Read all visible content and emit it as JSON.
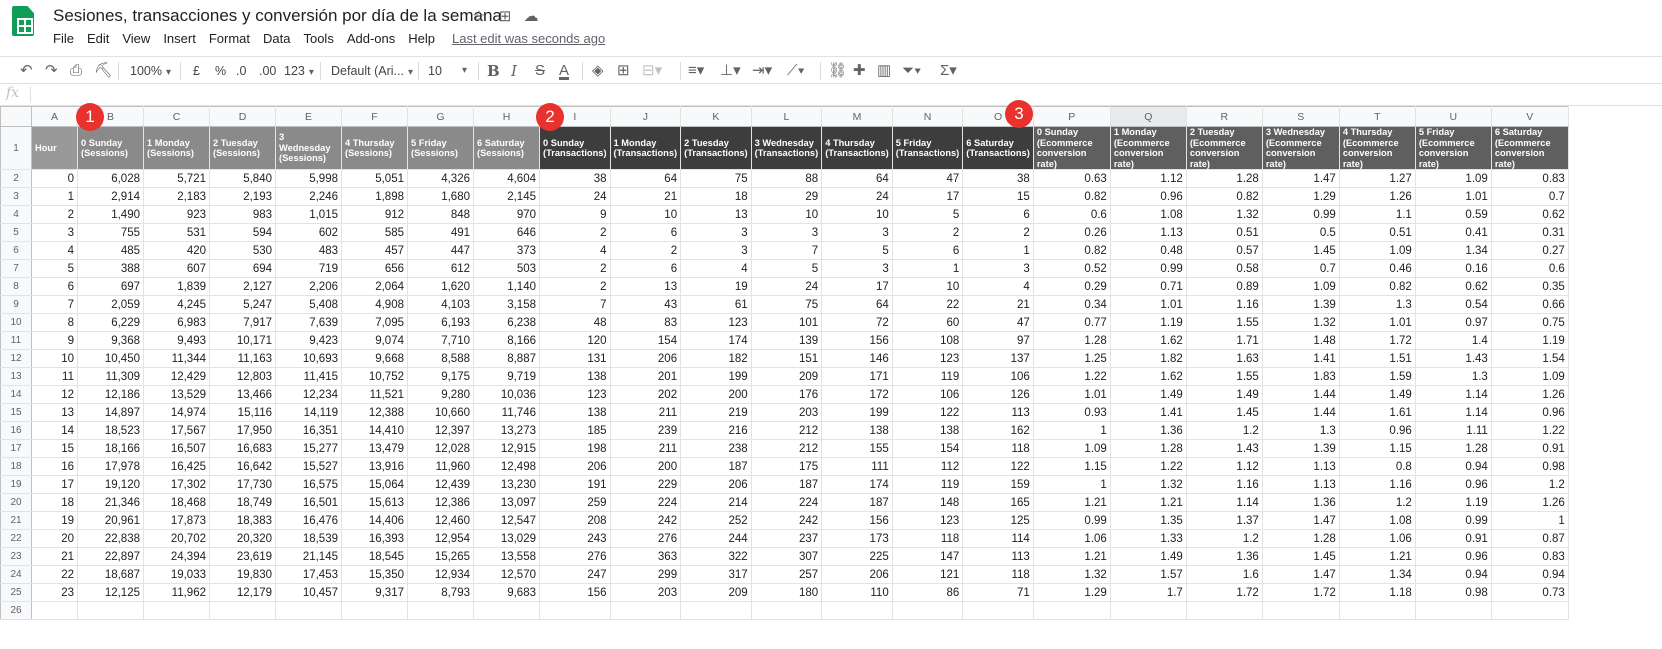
{
  "doc": {
    "title": "Sesiones, transacciones y conversión por día de la semana",
    "menus": [
      "File",
      "Edit",
      "View",
      "Insert",
      "Format",
      "Data",
      "Tools",
      "Add-ons",
      "Help"
    ],
    "last_edit": "Last edit was seconds ago"
  },
  "toolbar": {
    "zoom": "100%",
    "currency": "£",
    "percent": "%",
    "dec_less": ".0",
    "dec_more": ".00",
    "more_formats": "123",
    "font": "Default (Ari...",
    "font_size": "10"
  },
  "formula": {
    "fx": "fx",
    "value": ""
  },
  "columns": [
    "A",
    "B",
    "C",
    "D",
    "E",
    "F",
    "G",
    "H",
    "I",
    "J",
    "K",
    "L",
    "M",
    "N",
    "O",
    "P",
    "Q",
    "R",
    "S",
    "T",
    "U",
    "V"
  ],
  "header_labels": [
    "Hour",
    "0 Sunday (Sessions)",
    "1 Monday (Sessions)",
    "2 Tuesday (Sessions)",
    "3 Wednesday (Sessions)",
    "4 Thursday (Sessions)",
    "5 Friday (Sessions)",
    "6 Saturday (Sessions)",
    "0 Sunday (Transactions)",
    "1 Monday (Transactions)",
    "2 Tuesday (Transactions)",
    "3 Wednesday (Transactions)",
    "4 Thursday (Transactions)",
    "5 Friday (Transactions)",
    "6 Saturday (Transactions)",
    "0 Sunday (Ecommerce conversion rate)",
    "1 Monday (Ecommerce conversion rate)",
    "2 Tuesday (Ecommerce conversion rate)",
    "3 Wednesday (Ecommerce conversion rate)",
    "4 Thursday (Ecommerce conversion rate)",
    "5 Friday (Ecommerce conversion rate)",
    "6 Saturday (Ecommerce conversion rate)"
  ],
  "rows": [
    [
      "0",
      "6,028",
      "5,721",
      "5,840",
      "5,998",
      "5,051",
      "4,326",
      "4,604",
      "38",
      "64",
      "75",
      "88",
      "64",
      "47",
      "38",
      "0.63",
      "1.12",
      "1.28",
      "1.47",
      "1.27",
      "1.09",
      "0.83"
    ],
    [
      "1",
      "2,914",
      "2,183",
      "2,193",
      "2,246",
      "1,898",
      "1,680",
      "2,145",
      "24",
      "21",
      "18",
      "29",
      "24",
      "17",
      "15",
      "0.82",
      "0.96",
      "0.82",
      "1.29",
      "1.26",
      "1.01",
      "0.7"
    ],
    [
      "2",
      "1,490",
      "923",
      "983",
      "1,015",
      "912",
      "848",
      "970",
      "9",
      "10",
      "13",
      "10",
      "10",
      "5",
      "6",
      "0.6",
      "1.08",
      "1.32",
      "0.99",
      "1.1",
      "0.59",
      "0.62"
    ],
    [
      "3",
      "755",
      "531",
      "594",
      "602",
      "585",
      "491",
      "646",
      "2",
      "6",
      "3",
      "3",
      "3",
      "2",
      "2",
      "0.26",
      "1.13",
      "0.51",
      "0.5",
      "0.51",
      "0.41",
      "0.31"
    ],
    [
      "4",
      "485",
      "420",
      "530",
      "483",
      "457",
      "447",
      "373",
      "4",
      "2",
      "3",
      "7",
      "5",
      "6",
      "1",
      "0.82",
      "0.48",
      "0.57",
      "1.45",
      "1.09",
      "1.34",
      "0.27"
    ],
    [
      "5",
      "388",
      "607",
      "694",
      "719",
      "656",
      "612",
      "503",
      "2",
      "6",
      "4",
      "5",
      "3",
      "1",
      "3",
      "0.52",
      "0.99",
      "0.58",
      "0.7",
      "0.46",
      "0.16",
      "0.6"
    ],
    [
      "6",
      "697",
      "1,839",
      "2,127",
      "2,206",
      "2,064",
      "1,620",
      "1,140",
      "2",
      "13",
      "19",
      "24",
      "17",
      "10",
      "4",
      "0.29",
      "0.71",
      "0.89",
      "1.09",
      "0.82",
      "0.62",
      "0.35"
    ],
    [
      "7",
      "2,059",
      "4,245",
      "5,247",
      "5,408",
      "4,908",
      "4,103",
      "3,158",
      "7",
      "43",
      "61",
      "75",
      "64",
      "22",
      "21",
      "0.34",
      "1.01",
      "1.16",
      "1.39",
      "1.3",
      "0.54",
      "0.66"
    ],
    [
      "8",
      "6,229",
      "6,983",
      "7,917",
      "7,639",
      "7,095",
      "6,193",
      "6,238",
      "48",
      "83",
      "123",
      "101",
      "72",
      "60",
      "47",
      "0.77",
      "1.19",
      "1.55",
      "1.32",
      "1.01",
      "0.97",
      "0.75"
    ],
    [
      "9",
      "9,368",
      "9,493",
      "10,171",
      "9,423",
      "9,074",
      "7,710",
      "8,166",
      "120",
      "154",
      "174",
      "139",
      "156",
      "108",
      "97",
      "1.28",
      "1.62",
      "1.71",
      "1.48",
      "1.72",
      "1.4",
      "1.19"
    ],
    [
      "10",
      "10,450",
      "11,344",
      "11,163",
      "10,693",
      "9,668",
      "8,588",
      "8,887",
      "131",
      "206",
      "182",
      "151",
      "146",
      "123",
      "137",
      "1.25",
      "1.82",
      "1.63",
      "1.41",
      "1.51",
      "1.43",
      "1.54"
    ],
    [
      "11",
      "11,309",
      "12,429",
      "12,803",
      "11,415",
      "10,752",
      "9,175",
      "9,719",
      "138",
      "201",
      "199",
      "209",
      "171",
      "119",
      "106",
      "1.22",
      "1.62",
      "1.55",
      "1.83",
      "1.59",
      "1.3",
      "1.09"
    ],
    [
      "12",
      "12,186",
      "13,529",
      "13,466",
      "12,234",
      "11,521",
      "9,280",
      "10,036",
      "123",
      "202",
      "200",
      "176",
      "172",
      "106",
      "126",
      "1.01",
      "1.49",
      "1.49",
      "1.44",
      "1.49",
      "1.14",
      "1.26"
    ],
    [
      "13",
      "14,897",
      "14,974",
      "15,116",
      "14,119",
      "12,388",
      "10,660",
      "11,746",
      "138",
      "211",
      "219",
      "203",
      "199",
      "122",
      "113",
      "0.93",
      "1.41",
      "1.45",
      "1.44",
      "1.61",
      "1.14",
      "0.96"
    ],
    [
      "14",
      "18,523",
      "17,567",
      "17,950",
      "16,351",
      "14,410",
      "12,397",
      "13,273",
      "185",
      "239",
      "216",
      "212",
      "138",
      "138",
      "162",
      "1",
      "1.36",
      "1.2",
      "1.3",
      "0.96",
      "1.11",
      "1.22"
    ],
    [
      "15",
      "18,166",
      "16,507",
      "16,683",
      "15,277",
      "13,479",
      "12,028",
      "12,915",
      "198",
      "211",
      "238",
      "212",
      "155",
      "154",
      "118",
      "1.09",
      "1.28",
      "1.43",
      "1.39",
      "1.15",
      "1.28",
      "0.91"
    ],
    [
      "16",
      "17,978",
      "16,425",
      "16,642",
      "15,527",
      "13,916",
      "11,960",
      "12,498",
      "206",
      "200",
      "187",
      "175",
      "111",
      "112",
      "122",
      "1.15",
      "1.22",
      "1.12",
      "1.13",
      "0.8",
      "0.94",
      "0.98"
    ],
    [
      "17",
      "19,120",
      "17,302",
      "17,730",
      "16,575",
      "15,064",
      "12,439",
      "13,230",
      "191",
      "229",
      "206",
      "187",
      "174",
      "119",
      "159",
      "1",
      "1.32",
      "1.16",
      "1.13",
      "1.16",
      "0.96",
      "1.2"
    ],
    [
      "18",
      "21,346",
      "18,468",
      "18,749",
      "16,501",
      "15,613",
      "12,386",
      "13,097",
      "259",
      "224",
      "214",
      "224",
      "187",
      "148",
      "165",
      "1.21",
      "1.21",
      "1.14",
      "1.36",
      "1.2",
      "1.19",
      "1.26"
    ],
    [
      "19",
      "20,961",
      "17,873",
      "18,383",
      "16,476",
      "14,406",
      "12,460",
      "12,547",
      "208",
      "242",
      "252",
      "242",
      "156",
      "123",
      "125",
      "0.99",
      "1.35",
      "1.37",
      "1.47",
      "1.08",
      "0.99",
      "1"
    ],
    [
      "20",
      "22,838",
      "20,702",
      "20,320",
      "18,539",
      "16,393",
      "12,954",
      "13,029",
      "243",
      "276",
      "244",
      "237",
      "173",
      "118",
      "114",
      "1.06",
      "1.33",
      "1.2",
      "1.28",
      "1.06",
      "0.91",
      "0.87"
    ],
    [
      "21",
      "22,897",
      "24,394",
      "23,619",
      "21,145",
      "18,545",
      "15,265",
      "13,558",
      "276",
      "363",
      "322",
      "307",
      "225",
      "147",
      "113",
      "1.21",
      "1.49",
      "1.36",
      "1.45",
      "1.21",
      "0.96",
      "0.83"
    ],
    [
      "22",
      "18,687",
      "19,033",
      "19,830",
      "17,453",
      "15,350",
      "12,934",
      "12,570",
      "247",
      "299",
      "317",
      "257",
      "206",
      "121",
      "118",
      "1.32",
      "1.57",
      "1.6",
      "1.47",
      "1.34",
      "0.94",
      "0.94"
    ],
    [
      "23",
      "12,125",
      "11,962",
      "12,179",
      "10,457",
      "9,317",
      "8,793",
      "9,683",
      "156",
      "203",
      "209",
      "180",
      "110",
      "86",
      "71",
      "1.29",
      "1.7",
      "1.72",
      "1.72",
      "1.18",
      "0.98",
      "0.73"
    ]
  ],
  "callouts": [
    "1",
    "2",
    "3"
  ],
  "colors": {
    "hour_header": "#999999",
    "sessions_header": "#8a8a8a",
    "transactions_header": "#3d3d3d",
    "conversion_header": "#5f5f5f",
    "callout": "#e9322d",
    "sheets_green": "#0f9d58"
  },
  "icons": [
    "sheets-logo-icon",
    "star-icon",
    "move-to-folder-icon",
    "cloud-status-icon",
    "undo-icon",
    "redo-icon",
    "print-icon",
    "paint-format-icon",
    "bold-icon",
    "italic-icon",
    "strikethrough-icon",
    "text-color-icon",
    "fill-color-icon",
    "borders-icon",
    "merge-cells-icon",
    "align-horizontal-icon",
    "align-vertical-icon",
    "text-wrap-icon",
    "text-rotate-icon",
    "link-icon",
    "comment-icon",
    "chart-icon",
    "filter-icon",
    "functions-icon"
  ]
}
